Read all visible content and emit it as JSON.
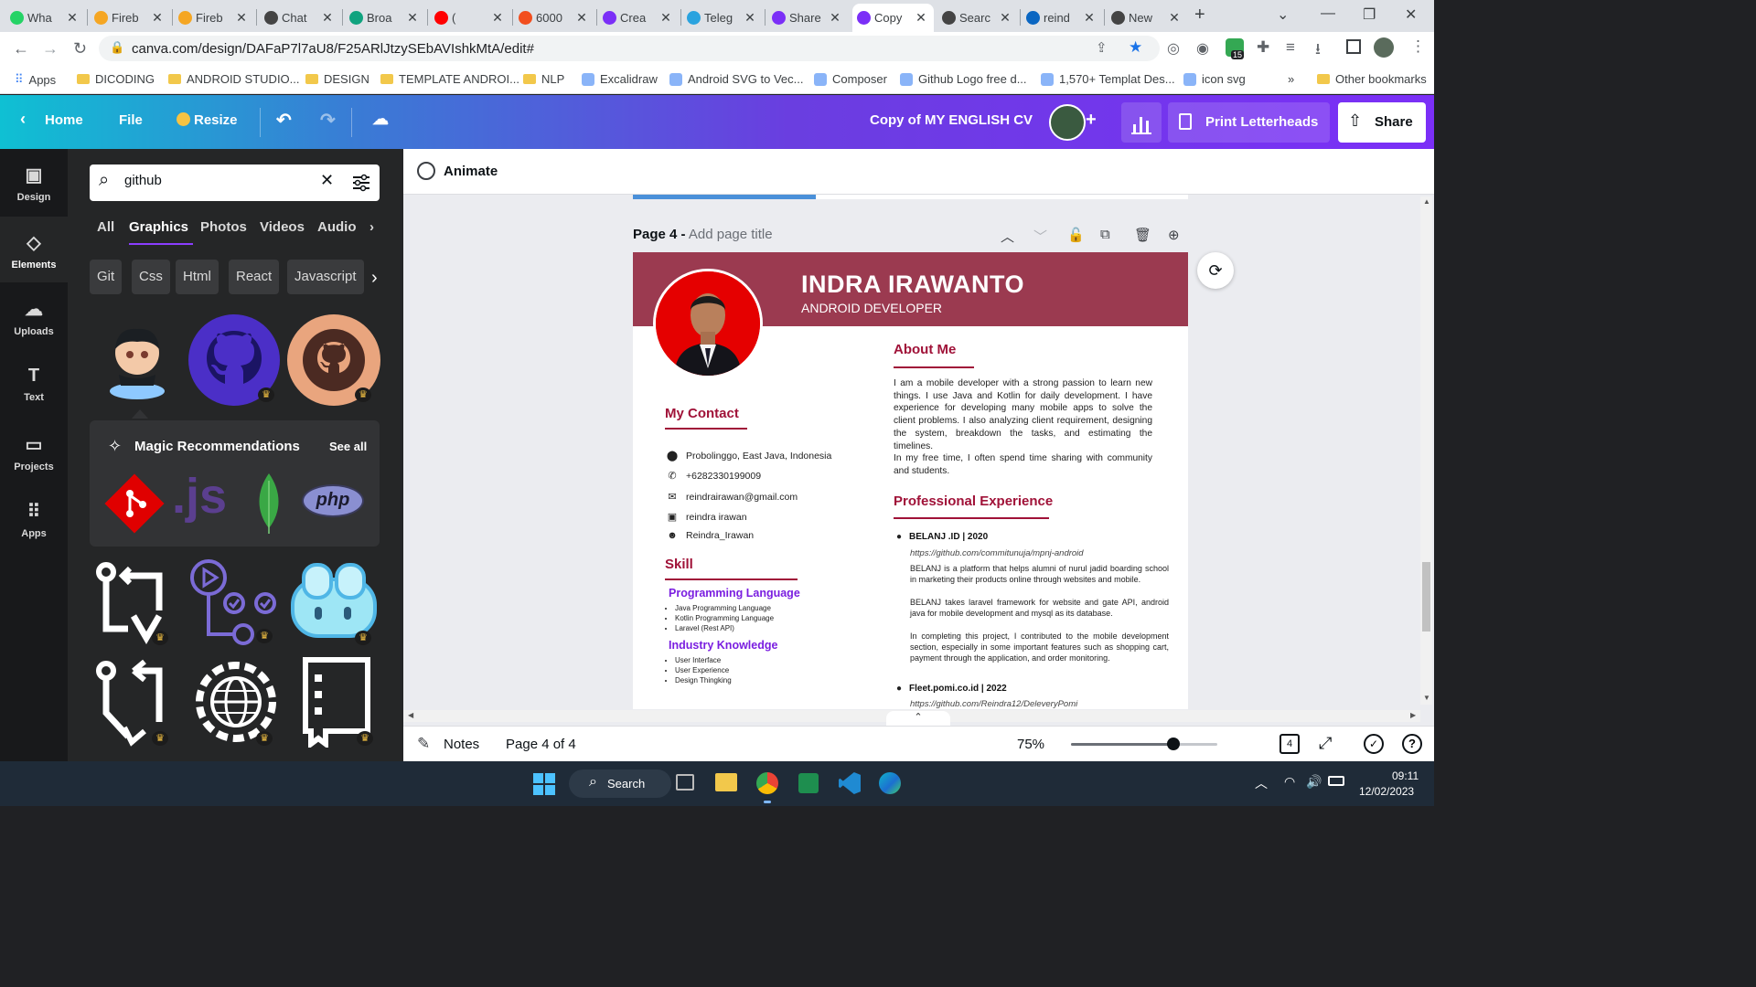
{
  "browser": {
    "tabs": [
      {
        "label": "Wha",
        "color": "#25d366"
      },
      {
        "label": "Fireb",
        "color": "#f5a623"
      },
      {
        "label": "Fireb",
        "color": "#f5a623"
      },
      {
        "label": "Chat",
        "color": "#444444"
      },
      {
        "label": "Broa",
        "color": "#10a37f"
      },
      {
        "label": "(",
        "color": "#ff0000"
      },
      {
        "label": "6000",
        "color": "#f24e1e"
      },
      {
        "label": "Crea",
        "color": "#7b2ff7"
      },
      {
        "label": "Teleg",
        "color": "#2aa3df"
      },
      {
        "label": "Share",
        "color": "#7b2ff7"
      },
      {
        "label": "Copy",
        "color": "#7b2ff7"
      },
      {
        "label": "Searc",
        "color": "#444444"
      },
      {
        "label": "reind",
        "color": "#0a66c2"
      },
      {
        "label": "New",
        "color": "#444444"
      }
    ],
    "url": "canva.com/design/DAFaP7l7aU8/F25ARlJtzySEbAVIshkMtA/edit#",
    "extension_badge": "15",
    "bookmarks": [
      "Apps",
      "DICODING",
      "ANDROID STUDIO...",
      "DESIGN",
      "TEMPLATE ANDROI...",
      "NLP",
      "Excalidraw",
      "Android SVG to Vec...",
      "Composer",
      "Github Logo free d...",
      "1,570+ Templat Des...",
      "icon svg"
    ],
    "other_bookmarks": "Other bookmarks",
    "more_bookmarks": "»"
  },
  "canva_header": {
    "home": "Home",
    "file": "File",
    "resize": "Resize",
    "design_title": "Copy of MY ENGLISH CV",
    "print_button": "Print Letterheads",
    "share_button": "Share"
  },
  "left_rail": [
    {
      "label": "Design",
      "icon": "design-icon"
    },
    {
      "label": "Elements",
      "icon": "elements-icon"
    },
    {
      "label": "Uploads",
      "icon": "uploads-icon"
    },
    {
      "label": "Text",
      "icon": "text-icon"
    },
    {
      "label": "Projects",
      "icon": "projects-icon"
    },
    {
      "label": "Apps",
      "icon": "apps-icon"
    }
  ],
  "panel": {
    "search_value": "github",
    "tabs": [
      "All",
      "Graphics",
      "Photos",
      "Videos",
      "Audio"
    ],
    "active_tab": "Graphics",
    "chips": [
      "Git",
      "Css",
      "Html",
      "React",
      "Javascript"
    ],
    "magic_title": "Magic Recommendations",
    "see_all": "See all",
    "js_text": ".js",
    "php_text": "php"
  },
  "editor": {
    "animate": "Animate",
    "page_label": "Page 4 -",
    "page_title_placeholder": "Add page title"
  },
  "cv": {
    "name": "INDRA IRAWANTO",
    "role": "ANDROID DEVELOPER",
    "about_title": "About Me",
    "about_text": "I am a mobile developer with a strong passion to learn new things. I use Java and Kotlin for daily development. I have experience for developing many mobile apps to solve the client problems. I also analyzing client requirement, designing the system, breakdown the tasks, and estimating the timelines.",
    "about_text2": "In my free time, I often spend time sharing with community and students.",
    "contact_title": "My Contact",
    "contacts": [
      {
        "icon": "location-pin-icon",
        "text": "Probolinggo, East Java, Indonesia"
      },
      {
        "icon": "phone-icon",
        "text": "+6282330199009"
      },
      {
        "icon": "mail-icon",
        "text": "reindrairawan@gmail.com"
      },
      {
        "icon": "linkedin-icon",
        "text": "reindra irawan"
      },
      {
        "icon": "github-icon",
        "text": "Reindra_Irawan"
      }
    ],
    "skill_title": "Skill",
    "programming_title": "Programming Language",
    "programming_items": [
      "Java Programming Language",
      "Kotlin Programming Language",
      "Laravel (Rest API)"
    ],
    "industry_title": "Industry Knowledge",
    "industry_items": [
      "User Interface",
      "User Experience",
      "Design Thingking"
    ],
    "experience_title": "Professional Experience",
    "exp1_title": "BELANJ .ID | 2020",
    "exp1_link": "https://github.com/commitunuja/mpnj-android",
    "exp1_p1": "BELANJ is a platform that helps alumni of nurul jadid boarding school in marketing their products online through websites and mobile.",
    "exp1_p2": "BELANJ takes laravel framework for website and gate API, android java for mobile development and mysql as its database.",
    "exp1_p3": "In completing this project, I contributed to the mobile development section, especially in some important features such as shopping cart, payment through the application, and order monitoring.",
    "exp2_title": "Fleet.pomi.co.id | 2022",
    "exp2_link": "https://github.com/Reindra12/DeleveryPomi"
  },
  "bottom": {
    "notes": "Notes",
    "page_counter": "Page 4 of 4",
    "zoom": "75%",
    "zoom_fraction": 0.7,
    "page_badge": "4"
  },
  "taskbar": {
    "search": "Search",
    "time": "09:11",
    "date": "12/02/2023"
  }
}
